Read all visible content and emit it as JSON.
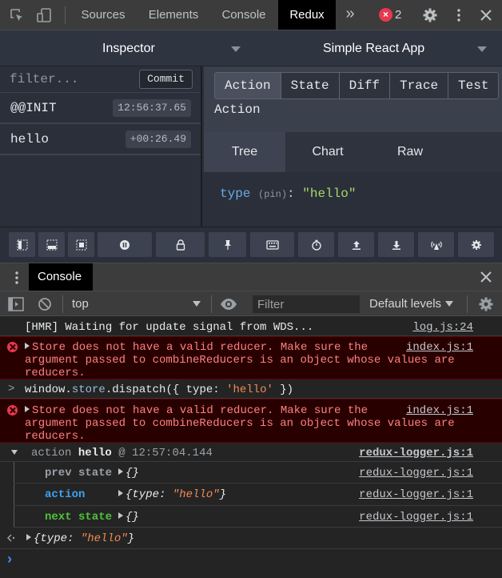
{
  "devtools": {
    "tabs": [
      "Sources",
      "Elements",
      "Console",
      "Redux"
    ],
    "active_tab": "Redux",
    "more_tabs": "»",
    "error_count": "2",
    "icons": [
      "inspect-element-icon",
      "device-toolbar-icon",
      "more-tabs-icon",
      "error-icon",
      "settings-icon",
      "kebab-menu-icon",
      "close-icon"
    ]
  },
  "redux": {
    "header": {
      "left_select": "Inspector",
      "right_select": "Simple React App"
    },
    "filter_placeholder": "filter...",
    "commit_label": "Commit",
    "actions": [
      {
        "name": "@@INIT",
        "time": "12:56:37.65"
      },
      {
        "name": "hello",
        "time": "+00:26.49"
      }
    ],
    "inspector_tabs": [
      "Action",
      "State",
      "Diff",
      "Trace",
      "Test"
    ],
    "active_inspector_tab": "Action",
    "section_title": "Action",
    "view_tabs": [
      "Tree",
      "Chart",
      "Raw"
    ],
    "active_view_tab": "Tree",
    "tree": {
      "key": "type",
      "pin": "(pin)",
      "colon": ":",
      "value": "\"hello\""
    },
    "toolbar_icons": [
      "left-pane-icon",
      "bottom-pane-icon",
      "remote-icon",
      "pause-icon",
      "lock-icon",
      "pin-icon",
      "keyboard-icon",
      "timer-icon",
      "upload-icon",
      "download-icon",
      "remote-monitor-icon",
      "settings-icon"
    ]
  },
  "drawer": {
    "tab": "Console",
    "context": "top",
    "filter_placeholder": "Filter",
    "levels": "Default levels"
  },
  "console": {
    "hmr": {
      "text": "[HMR] Waiting for update signal from WDS...",
      "source": "log.js:24"
    },
    "error1": {
      "lines": [
        "Store does not have a valid reducer. Make sure the",
        "argument passed to combineReducers is an object whose values are",
        "reducers."
      ],
      "source": "index.js:1"
    },
    "input": {
      "prompt": ">",
      "pre": "window.",
      "obj": "store",
      "mid": ".dispatch({ type: ",
      "str": "'hello'",
      "post": " })"
    },
    "error2": {
      "lines": [
        "Store does not have a valid reducer. Make sure the",
        "argument passed to combineReducers is an object whose values are",
        "reducers."
      ],
      "source": "index.js:1"
    },
    "group": {
      "word": "action",
      "name": "hello",
      "at": "@ 12:57:04.144",
      "source": "redux-logger.js:1"
    },
    "prev": {
      "label": "prev state",
      "value": "{}",
      "source": "redux-logger.js:1"
    },
    "action": {
      "label": "action",
      "pre": "{",
      "key": "type",
      "colon": ": ",
      "value": "\"hello\"",
      "post": "}",
      "source": "redux-logger.js:1"
    },
    "next": {
      "label": "next state",
      "value": "{}",
      "source": "redux-logger.js:1"
    },
    "result": {
      "pre": "{",
      "key": "type",
      "colon": ": ",
      "value": "\"hello\"",
      "post": "}"
    },
    "prompt": "›"
  },
  "colors": {
    "error": "#e8384f",
    "accent_blue": "#3ea3f3",
    "prompt_blue": "#3d8ff8",
    "green": "#4ec33a",
    "orange": "#f28b54"
  }
}
